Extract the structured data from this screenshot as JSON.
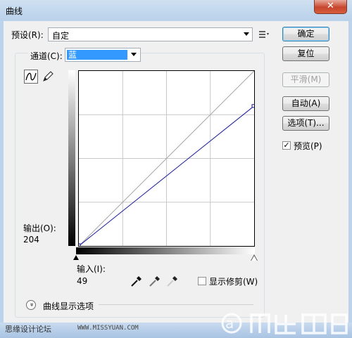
{
  "window": {
    "title": "曲线",
    "close_glyph": "✕"
  },
  "preset": {
    "label": "预设(R):",
    "value": "自定"
  },
  "channel": {
    "label": "通道(C):",
    "value": "蓝"
  },
  "buttons": {
    "ok": "确定",
    "reset": "复位",
    "smooth": "平滑(M)",
    "auto": "自动(A)",
    "options": "选项(T)..."
  },
  "preview": {
    "label": "预览(P)",
    "checked": true,
    "check_glyph": "✓"
  },
  "output": {
    "label": "输出(O):",
    "value": "204"
  },
  "input": {
    "label": "输入(I):",
    "value": "49"
  },
  "show_clipping": {
    "label": "显示修剪(W)",
    "checked": false
  },
  "curve_options": {
    "label": "曲线显示选项",
    "glyph": "»"
  },
  "watermark": {
    "text": "思缘设计论坛",
    "url": "WWW.MISSYUAN.COM"
  },
  "curve": {
    "color": "#1a1a9a",
    "start": [
      0,
      0
    ],
    "end": [
      255,
      204
    ],
    "grid_divisions": 4
  },
  "icons": {
    "curve_tool": "curve-tool-icon",
    "pencil_tool": "pencil-icon",
    "preset_options": "preset-options-icon",
    "black_eyedropper": "eyedropper-black-icon",
    "gray_eyedropper": "eyedropper-gray-icon",
    "white_eyedropper": "eyedropper-white-icon"
  }
}
